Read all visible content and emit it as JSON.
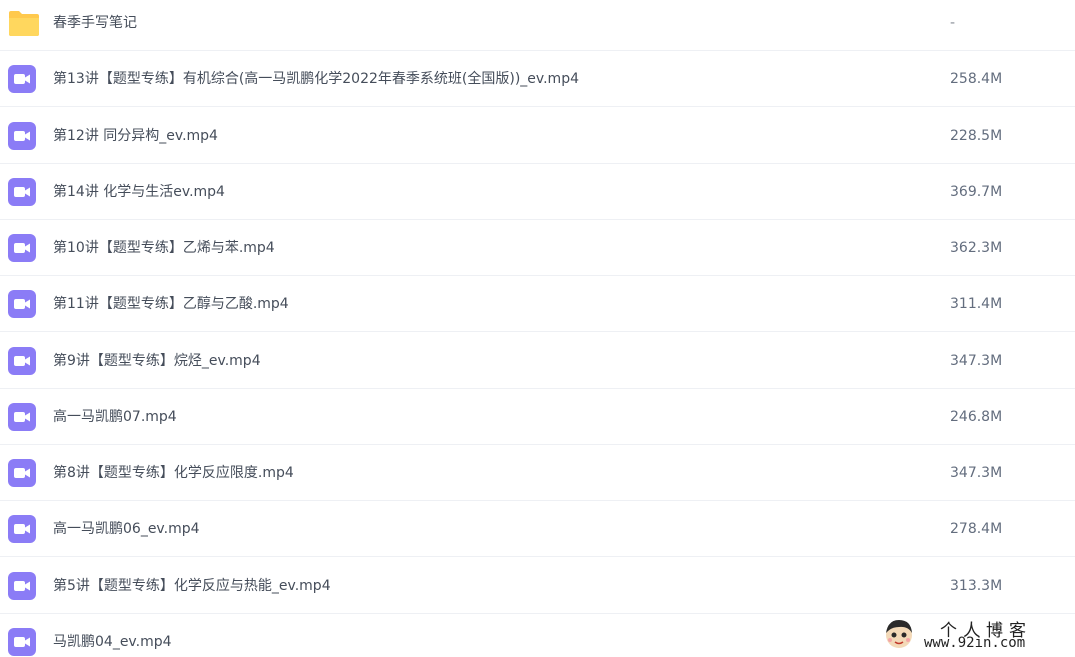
{
  "colors": {
    "folder_icon": "#ffc94d",
    "video_icon": "#8b7cf6",
    "row_divider": "#eef0f4",
    "name_text": "#454d5a",
    "size_text": "#636d7e"
  },
  "files": [
    {
      "type": "folder",
      "icon": "folder-icon",
      "name": "春季手写笔记",
      "size": "-"
    },
    {
      "type": "video",
      "icon": "video-icon",
      "name": "第13讲【题型专练】有机综合(高一马凯鹏化学2022年春季系统班(全国版))_ev.mp4",
      "size": "258.4M"
    },
    {
      "type": "video",
      "icon": "video-icon",
      "name": "第12讲 同分异构_ev.mp4",
      "size": "228.5M"
    },
    {
      "type": "video",
      "icon": "video-icon",
      "name": "第14讲 化学与生活ev.mp4",
      "size": "369.7M"
    },
    {
      "type": "video",
      "icon": "video-icon",
      "name": "第10讲【题型专练】乙烯与苯.mp4",
      "size": "362.3M"
    },
    {
      "type": "video",
      "icon": "video-icon",
      "name": "第11讲【题型专练】乙醇与乙酸.mp4",
      "size": "311.4M"
    },
    {
      "type": "video",
      "icon": "video-icon",
      "name": "第9讲【题型专练】烷烃_ev.mp4",
      "size": "347.3M"
    },
    {
      "type": "video",
      "icon": "video-icon",
      "name": "高一马凯鹏07.mp4",
      "size": "246.8M"
    },
    {
      "type": "video",
      "icon": "video-icon",
      "name": "第8讲【题型专练】化学反应限度.mp4",
      "size": "347.3M"
    },
    {
      "type": "video",
      "icon": "video-icon",
      "name": "高一马凯鹏06_ev.mp4",
      "size": "278.4M"
    },
    {
      "type": "video",
      "icon": "video-icon",
      "name": "第5讲【题型专练】化学反应与热能_ev.mp4",
      "size": "313.3M"
    },
    {
      "type": "video",
      "icon": "video-icon",
      "name": "马凯鹏04_ev.mp4",
      "size": ""
    }
  ],
  "watermark": {
    "title": "个人博客",
    "url": "www.92in.com"
  }
}
